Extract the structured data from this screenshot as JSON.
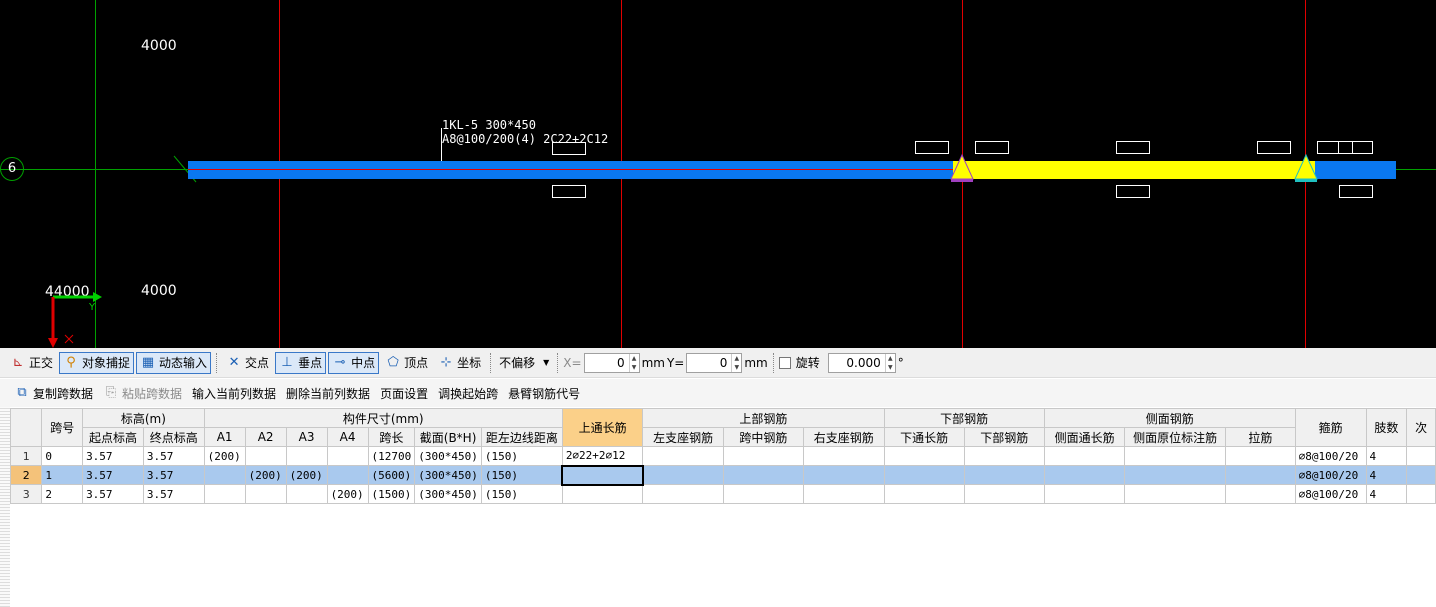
{
  "cad": {
    "axis_label_top": "4000",
    "axis_label_bottom": "4000",
    "coord_label": "44000",
    "grid_bubble": "6",
    "y_axis_letter": "Y",
    "x_axis_letter": "X",
    "beam_label_line1": "1KL-5 300*450",
    "beam_label_line2": "A8@100/200(4) 2C22+2C12",
    "colors": {
      "beam": "#0a78f0",
      "selected_span": "#ffff00",
      "axis_line": "#ff0000",
      "grid_line": "#00a000"
    }
  },
  "toolbar1": {
    "ortho": "正交",
    "snap": "对象捕捉",
    "dynamic_input": "动态输入",
    "intersection": "交点",
    "perpendicular": "垂点",
    "midpoint": "中点",
    "vertex": "顶点",
    "coordinate": "坐标",
    "offset_mode": "不偏移",
    "x_label": "X=",
    "x_value": "0",
    "y_label": "Y=",
    "y_value": "0",
    "unit": "mm",
    "rotate_label": "旋转",
    "rotate_value": "0.000",
    "degree": "°"
  },
  "toolbar2": {
    "copy_span": "复制跨数据",
    "paste_span": "粘贴跨数据",
    "input_column": "输入当前列数据",
    "delete_column": "删除当前列数据",
    "page_setup": "页面设置",
    "change_start_span": "调换起始跨",
    "cantilever_code": "悬臂钢筋代号"
  },
  "grid": {
    "header_groups": {
      "span": "跨号",
      "elevation": "标高(m)",
      "dimensions": "构件尺寸(mm)",
      "top_long": "上通长筋",
      "top_rebar": "上部钢筋",
      "bottom_rebar": "下部钢筋",
      "side_rebar": "侧面钢筋",
      "stirrup": "箍筋",
      "legs": "肢数",
      "next": "次"
    },
    "sub_headers": {
      "start_elev": "起点标高",
      "end_elev": "终点标高",
      "a1": "A1",
      "a2": "A2",
      "a3": "A3",
      "a4": "A4",
      "span_len": "跨长",
      "section": "截面(B*H)",
      "left_dist": "距左边线距离",
      "left_support": "左支座钢筋",
      "mid_span": "跨中钢筋",
      "right_support": "右支座钢筋",
      "bottom_long": "下通长筋",
      "bottom_rebar": "下部钢筋",
      "side_long": "侧面通长筋",
      "side_mark": "侧面原位标注筋",
      "tie": "拉筋"
    },
    "rows": [
      {
        "rn": "1",
        "span": "0",
        "start": "3.57",
        "end": "3.57",
        "a1": "(200)",
        "a2": "",
        "a3": "",
        "a4": "",
        "len": "(12700",
        "sec": "(300*450)",
        "dist": "(150)",
        "top_long": "2⌀22+2⌀12",
        "stirrup": "⌀8@100/20",
        "legs": "4"
      },
      {
        "rn": "2",
        "span": "1",
        "start": "3.57",
        "end": "3.57",
        "a1": "",
        "a2": "(200)",
        "a3": "(200)",
        "a4": "",
        "len": "(5600)",
        "sec": "(300*450)",
        "dist": "(150)",
        "top_long": "",
        "stirrup": "⌀8@100/20",
        "legs": "4"
      },
      {
        "rn": "3",
        "span": "2",
        "start": "3.57",
        "end": "3.57",
        "a1": "",
        "a2": "",
        "a3": "",
        "a4": "(200)",
        "len": "(1500)",
        "sec": "(300*450)",
        "dist": "(150)",
        "top_long": "",
        "stirrup": "⌀8@100/20",
        "legs": "4"
      }
    ]
  }
}
